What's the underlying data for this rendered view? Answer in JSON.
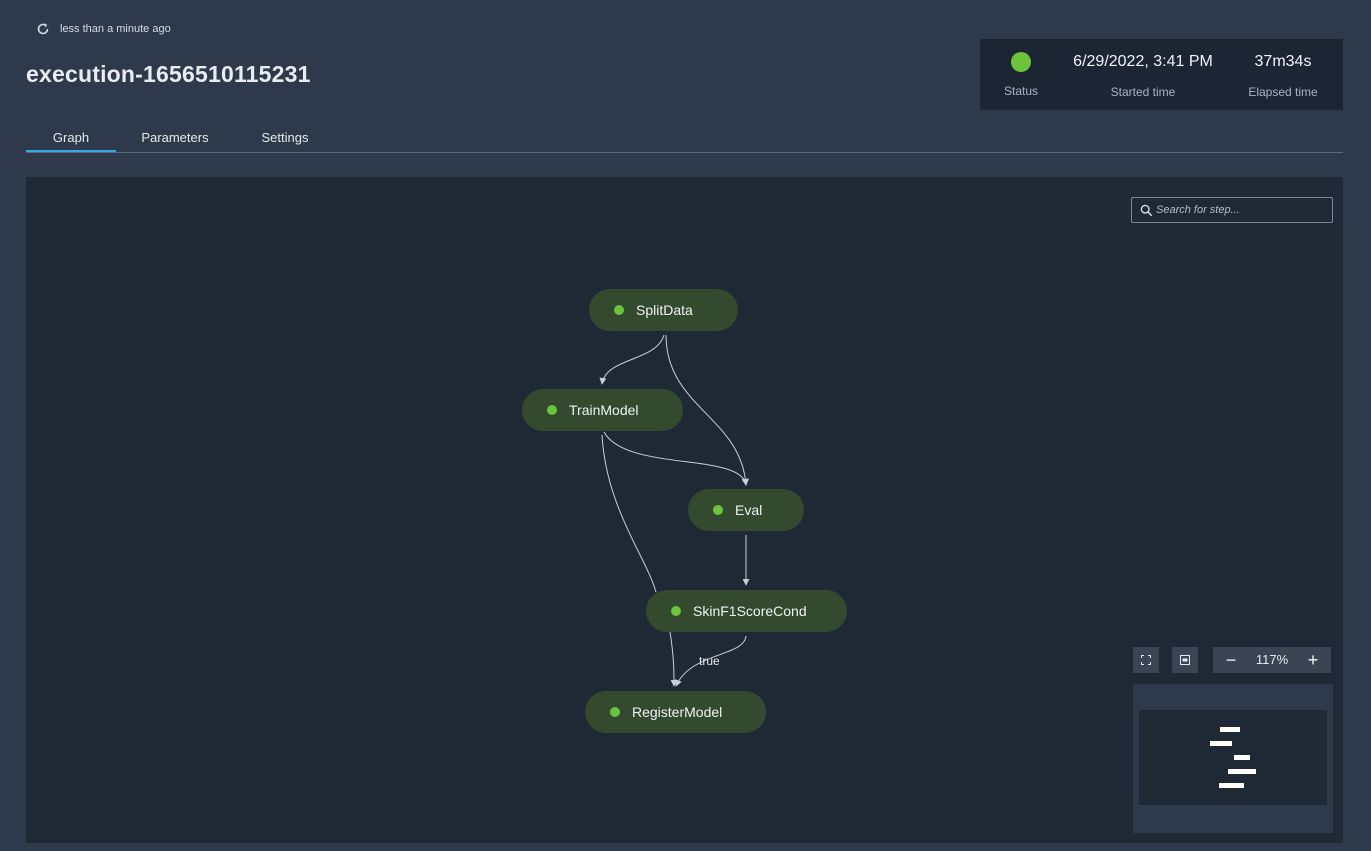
{
  "header": {
    "refresh_text": "less than a minute ago",
    "title": "execution-1656510115231"
  },
  "status_card": {
    "status_label": "Status",
    "status_color": "#6bc43a",
    "started_value": "6/29/2022, 3:41 PM",
    "started_label": "Started time",
    "elapsed_value": "37m34s",
    "elapsed_label": "Elapsed time"
  },
  "tabs": [
    {
      "label": "Graph",
      "active": true
    },
    {
      "label": "Parameters",
      "active": false
    },
    {
      "label": "Settings",
      "active": false
    }
  ],
  "graph": {
    "search_placeholder": "Search for step...",
    "nodes": [
      {
        "label": "SplitData",
        "status": "succeeded"
      },
      {
        "label": "TrainModel",
        "status": "succeeded"
      },
      {
        "label": "Eval",
        "status": "succeeded"
      },
      {
        "label": "SkinF1ScoreCond",
        "status": "succeeded"
      },
      {
        "label": "RegisterModel",
        "status": "succeeded"
      }
    ],
    "edge_label_true": "true",
    "zoom": {
      "minus": "−",
      "value": "117%",
      "plus": "+"
    },
    "node_color": "#344a2f"
  }
}
